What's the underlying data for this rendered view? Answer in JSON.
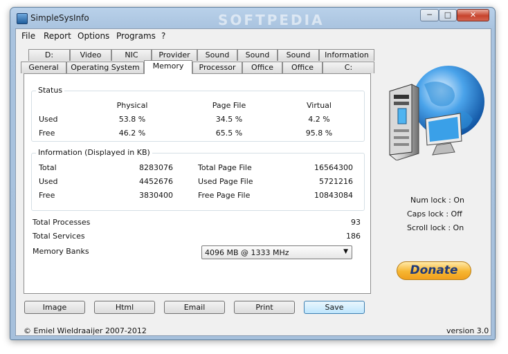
{
  "window": {
    "title": "SimpleSysInfo",
    "watermark": "SOFTPEDIA"
  },
  "menu": [
    "File",
    "Report",
    "Options",
    "Programs",
    "?"
  ],
  "tabs_top": [
    "D:",
    "Video",
    "NIC",
    "Provider",
    "Sound",
    "Sound",
    "Sound",
    "Information"
  ],
  "tabs_bottom": [
    "General",
    "Operating System",
    "Memory",
    "Processor",
    "Office",
    "Office",
    "C:"
  ],
  "active_tab": "Memory",
  "status": {
    "label": "Status",
    "headers": {
      "physical": "Physical",
      "pagefile": "Page File",
      "virtual": "Virtual"
    },
    "rows": [
      {
        "label": "Used",
        "physical": "53.8 %",
        "pagefile": "34.5 %",
        "virtual": "4.2 %"
      },
      {
        "label": "Free",
        "physical": "46.2 %",
        "pagefile": "65.5 %",
        "virtual": "95.8 %"
      }
    ]
  },
  "info": {
    "label": "Information (Displayed in KB)",
    "rows": [
      {
        "label": "Total",
        "value": "8283076",
        "label2": "Total Page File",
        "value2": "16564300"
      },
      {
        "label": "Used",
        "value": "4452676",
        "label2": "Used Page File",
        "value2": "5721216"
      },
      {
        "label": "Free",
        "value": "3830400",
        "label2": "Free Page File",
        "value2": "10843084"
      }
    ]
  },
  "totals": {
    "processes_label": "Total Processes",
    "processes": "93",
    "services_label": "Total Services",
    "services": "186",
    "banks_label": "Memory Banks",
    "banks_value": "4096 MB @ 1333 MHz"
  },
  "buttons": {
    "image": "Image",
    "html": "Html",
    "email": "Email",
    "print": "Print",
    "save": "Save"
  },
  "locks": {
    "num": "Num lock : On",
    "caps": "Caps lock : Off",
    "scroll": "Scroll lock : On"
  },
  "donate": "Donate",
  "footer": {
    "copyright": "© Emiel Wieldraaijer 2007-2012",
    "version": "version 3.0"
  }
}
